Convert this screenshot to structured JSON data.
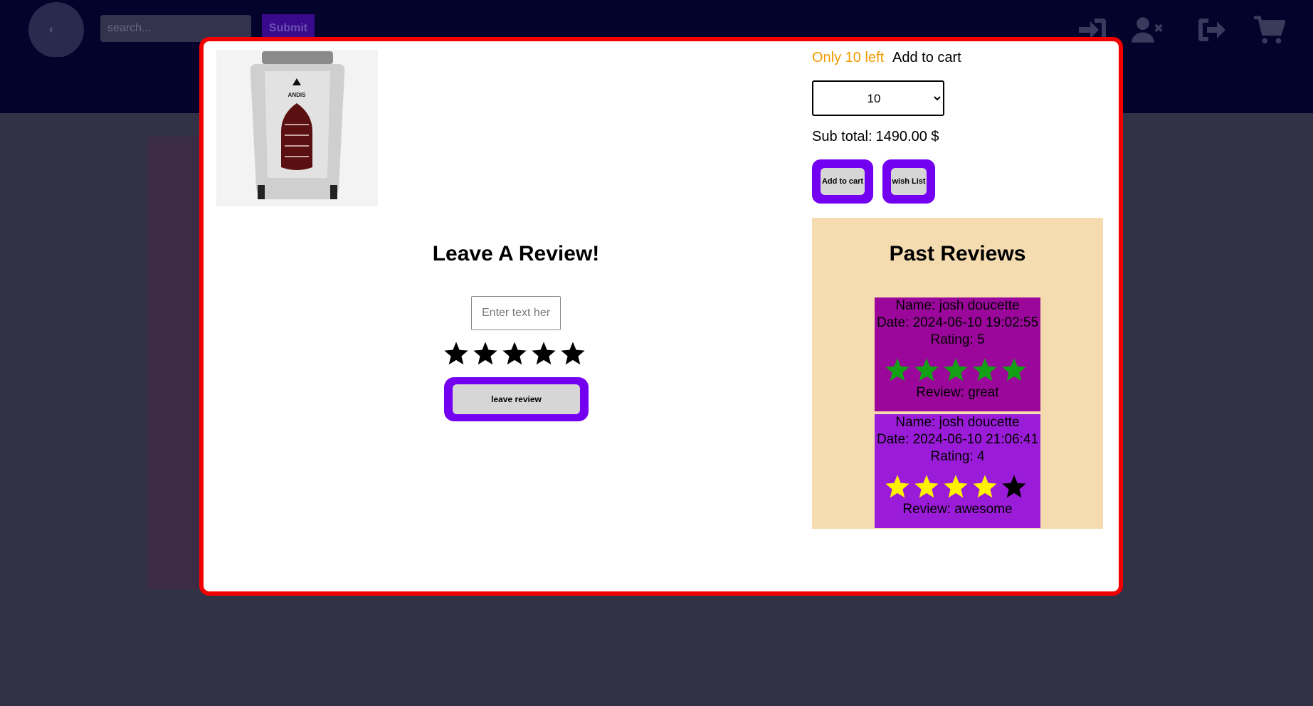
{
  "header": {
    "search_placeholder": "search...",
    "submit_label": "Submit",
    "icons": [
      "login-icon",
      "remove-user-icon",
      "logout-icon",
      "cart-icon"
    ],
    "bg_color": "#03032b"
  },
  "product": {
    "image_alt": "ANDIS",
    "brand_text": "ANDIS",
    "stock_text": "Only 10 left",
    "add_to_cart_text": "Add to cart",
    "quantity_selected": "10",
    "subtotal_label": "Sub total:",
    "subtotal_value": "1490.00 $",
    "add_to_cart_button": "Add to cart",
    "wishlist_button": "wish List"
  },
  "review_form": {
    "title": "Leave A Review!",
    "input_placeholder": "Enter text here",
    "rating_stars": 5,
    "submit_label": "leave review"
  },
  "past_reviews": {
    "title": "Past Reviews",
    "items": [
      {
        "name_line": "Name: josh doucette",
        "date_line": "Date: 2024-06-10 19:02:55",
        "rating_line": "Rating: 5",
        "rating": 5,
        "review_line": "Review: great",
        "bg": "#9a079a",
        "star_color": "#14a014"
      },
      {
        "name_line": "Name: josh doucette",
        "date_line": "Date: 2024-06-10 21:06:41",
        "rating_line": "Rating: 4",
        "rating": 4,
        "review_line": "Review: awesome",
        "bg": "#9b1cd8",
        "star_color": "#fff200"
      }
    ]
  },
  "colors": {
    "modal_border": "#f20000",
    "button_border": "#7400f2",
    "stock_color": "#f29b00",
    "past_reviews_bg": "#f5dcb0"
  }
}
